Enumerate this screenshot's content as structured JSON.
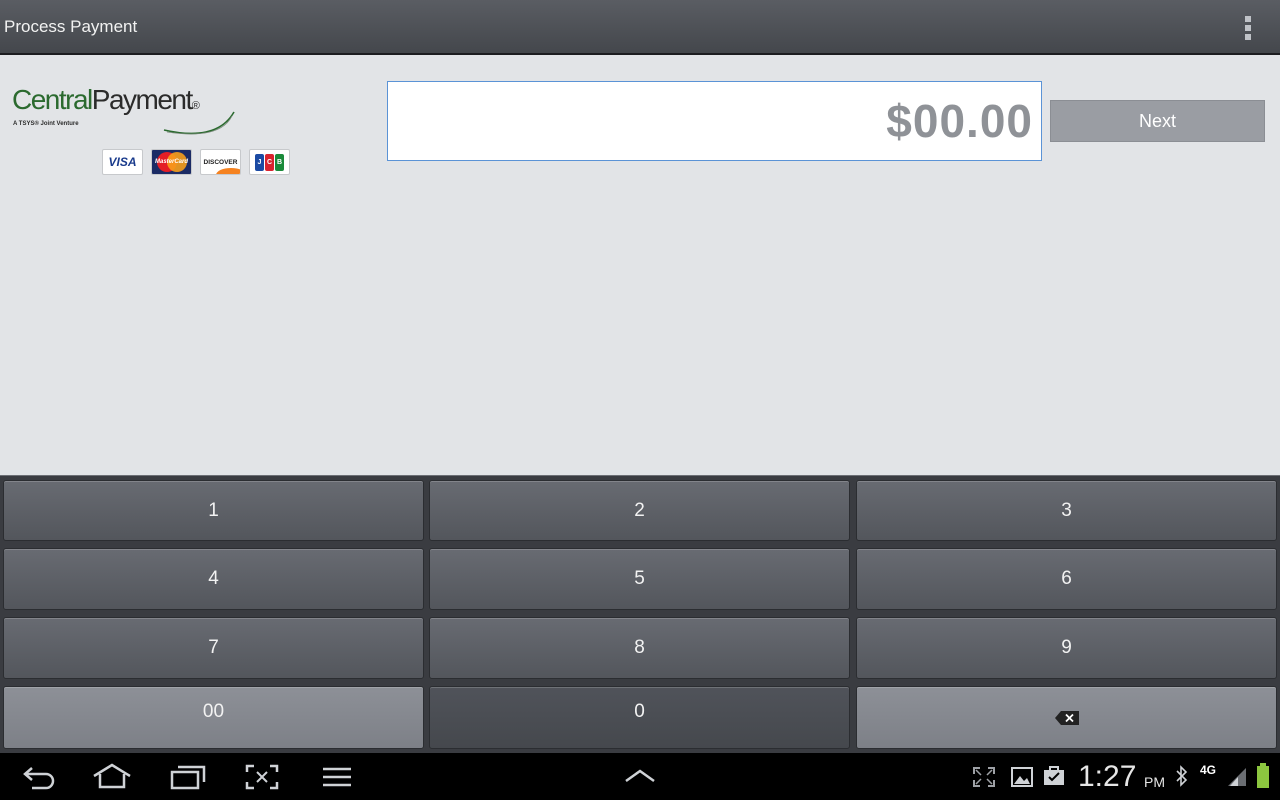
{
  "action_bar": {
    "title": "Process Payment",
    "overflow_icon": "overflow-menu-icon"
  },
  "logo": {
    "brand_part1": "Central",
    "brand_part2": "Payment",
    "registered": "®",
    "tagline": "A TSYS® Joint Venture"
  },
  "cards": {
    "visa": "VISA",
    "mastercard": "MasterCard",
    "discover": "DISCOVER",
    "jcb_letters": [
      "J",
      "C",
      "B"
    ],
    "jcb_colors": [
      "#1b4aa3",
      "#d9232e",
      "#1a8a3a"
    ]
  },
  "amount": {
    "value": "$00.00"
  },
  "next_button": {
    "label": "Next"
  },
  "keypad": {
    "keys": [
      "1",
      "2",
      "3",
      "4",
      "5",
      "6",
      "7",
      "8",
      "9",
      "00",
      "0"
    ],
    "backspace_icon": "backspace-icon"
  },
  "system_bar": {
    "time": "1:27",
    "ampm": "PM",
    "network": "4G",
    "nav_icons": [
      "back-icon",
      "home-icon",
      "recent-apps-icon",
      "screenshot-icon",
      "menu-icon"
    ],
    "center_icon": "chevron-up-icon",
    "status_icons": [
      "fullscreen-icon",
      "gallery-icon",
      "shopping-bag-icon",
      "bluetooth-icon",
      "signal-icon",
      "battery-icon"
    ]
  },
  "colors": {
    "accent_border": "#5b93d6",
    "battery": "#8cc63f",
    "brand_green": "#2b6a2f"
  }
}
